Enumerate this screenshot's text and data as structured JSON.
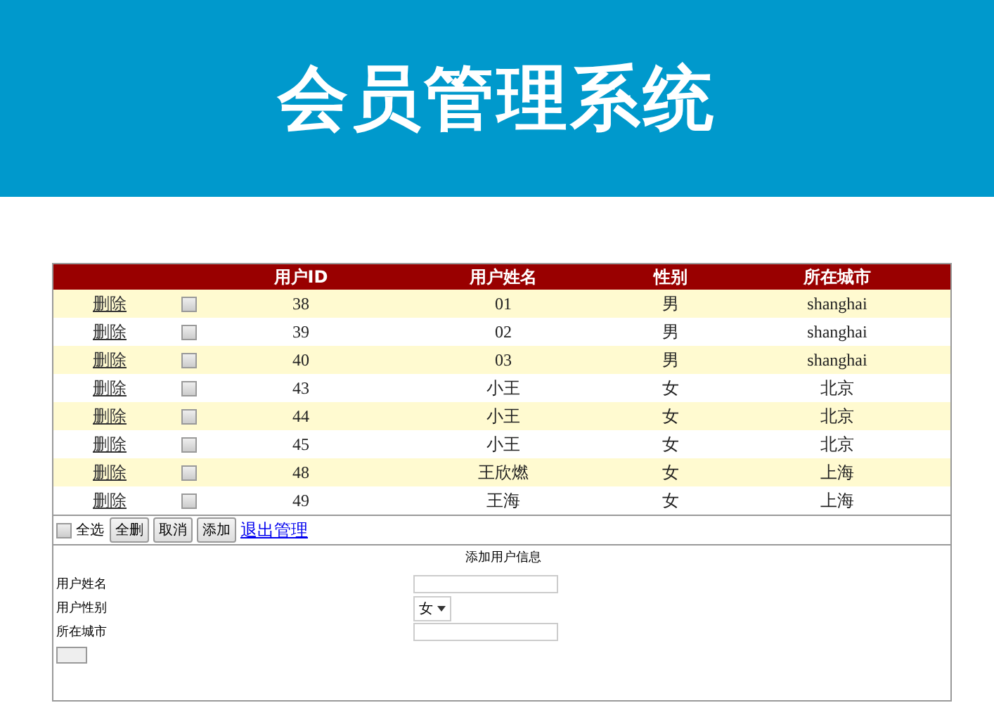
{
  "header": {
    "title": "会员管理系统"
  },
  "table": {
    "columns": [
      "用户ID",
      "用户姓名",
      "性别",
      "所在城市"
    ],
    "rows": [
      {
        "action": "删除",
        "checked": false,
        "id": "38",
        "name": "01",
        "gender": "男",
        "city": "shanghai"
      },
      {
        "action": "删除",
        "checked": false,
        "id": "39",
        "name": "02",
        "gender": "男",
        "city": "shanghai"
      },
      {
        "action": "删除",
        "checked": false,
        "id": "40",
        "name": "03",
        "gender": "男",
        "city": "shanghai"
      },
      {
        "action": "删除",
        "checked": false,
        "id": "43",
        "name": "小王",
        "gender": "女",
        "city": "北京"
      },
      {
        "action": "删除",
        "checked": false,
        "id": "44",
        "name": "小王",
        "gender": "女",
        "city": "北京"
      },
      {
        "action": "删除",
        "checked": false,
        "id": "45",
        "name": "小王",
        "gender": "女",
        "city": "北京"
      },
      {
        "action": "删除",
        "checked": false,
        "id": "48",
        "name": "王欣燃",
        "gender": "女",
        "city": "上海"
      },
      {
        "action": "删除",
        "checked": false,
        "id": "49",
        "name": "王海",
        "gender": "女",
        "city": "上海"
      }
    ]
  },
  "toolbar": {
    "select_all": {
      "label": "全选",
      "checked": false
    },
    "buttons": [
      "全删",
      "取消",
      "添加"
    ],
    "link": "退出管理"
  },
  "form": {
    "title": "添加用户信息",
    "fields": [
      {
        "kind": "text",
        "label": "用户姓名"
      },
      {
        "kind": "select",
        "label": "用户性别",
        "value": "女"
      },
      {
        "kind": "text",
        "label": "所在城市"
      }
    ],
    "submit_button": true
  }
}
